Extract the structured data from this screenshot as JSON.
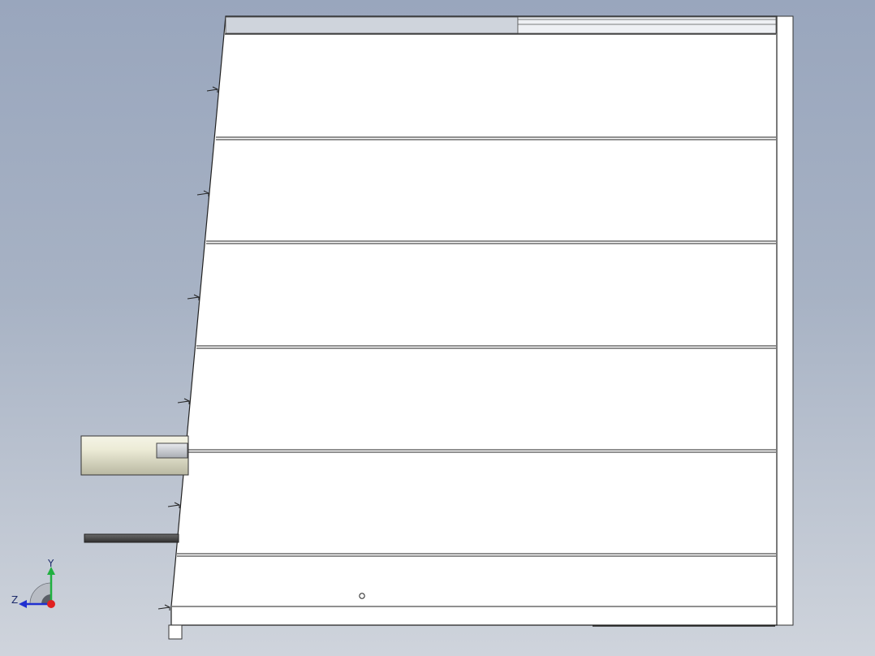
{
  "view": {
    "background_top": "#99a6bd",
    "background_bottom": "#cfd4dc"
  },
  "model": {
    "panel_fill": "#ffffff",
    "edge_color": "#222222",
    "header_fill": "#cfd4dc",
    "tube_color": "#dcdcc6",
    "rod_color": "#4a4a4a",
    "panel_count": 6,
    "bracket_count": 6,
    "hole_count": 1
  },
  "triad": {
    "x_color": "#e02020",
    "y_color": "#20b040",
    "z_color": "#2030d0",
    "y_label": "Y",
    "z_label": "Z"
  }
}
